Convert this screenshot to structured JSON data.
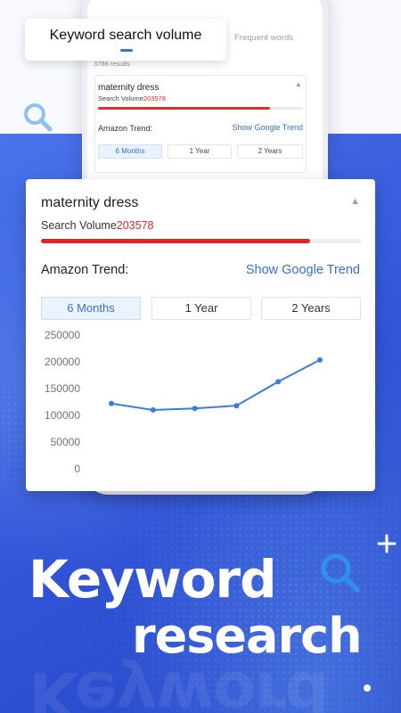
{
  "tag": {
    "label": "Keyword search volume"
  },
  "phone": {
    "tab_frequent": "Frequent words",
    "results_count": "3788 results",
    "keyword": "maternity dress",
    "search_volume_label": "Search Volume",
    "search_volume_value": "203578",
    "amazon_trend_label": "Amazon Trend:",
    "google_trend_link": "Show Google Trend",
    "ranges": [
      "6 Months",
      "1 Year",
      "2 Years"
    ],
    "volume_fill_fraction": 0.84
  },
  "card": {
    "keyword": "maternity dress",
    "search_volume_label": "Search Volume",
    "search_volume_value": "203578",
    "volume_fill_fraction": 0.84,
    "amazon_trend_label": "Amazon Trend:",
    "google_trend_link": "Show Google Trend",
    "ranges": [
      "6 Months",
      "1 Year",
      "2 Years"
    ],
    "selected_range": "6 Months"
  },
  "chart_data": {
    "type": "line",
    "x": [
      1,
      2,
      3,
      4,
      5,
      6
    ],
    "y_ticks": [
      "250000",
      "200000",
      "150000",
      "100000",
      "50000",
      "0"
    ],
    "ylim": [
      0,
      250000
    ],
    "series": [
      {
        "values": [
          122000,
          110000,
          113000,
          118000,
          163000,
          203578
        ]
      }
    ],
    "line_color": "#3a7be0",
    "grid": false
  },
  "headline": {
    "line1": "Keyword",
    "line2": "research",
    "reflection": "Keyword"
  },
  "icons": [
    "search-icon",
    "plus-icon",
    "collapse-arrow-icon"
  ],
  "colors": {
    "accent_blue": "#3a6fc6",
    "volume_red": "#e0262b",
    "background_blue": "#2a4fd6"
  }
}
